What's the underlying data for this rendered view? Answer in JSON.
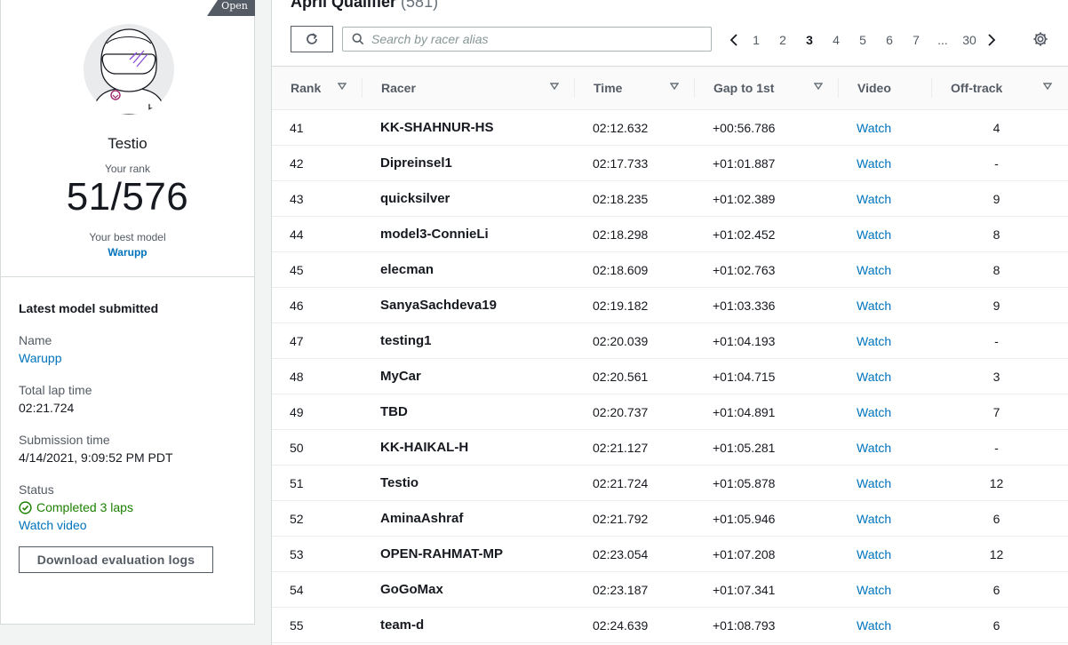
{
  "profile": {
    "badge": "Open",
    "racer_name": "Testio",
    "rank_label": "Your rank",
    "rank_value": "51/576",
    "best_model_label": "Your best model",
    "best_model": "Warupp"
  },
  "latest_model": {
    "heading": "Latest model submitted",
    "name_label": "Name",
    "name": "Warupp",
    "lap_label": "Total lap time",
    "lap_time": "02:21.724",
    "submission_label": "Submission time",
    "submission_time": "4/14/2021, 9:09:52 PM PDT",
    "status_label": "Status",
    "status": "Completed 3 laps",
    "watch_video": "Watch video",
    "download_button": "Download evaluation logs"
  },
  "leaderboard": {
    "title": "April Qualifier",
    "count": "(581)",
    "search_placeholder": "Search by racer alias",
    "pages": [
      "1",
      "2",
      "3",
      "4",
      "5",
      "6",
      "7"
    ],
    "current_page": "3",
    "ellipsis": "...",
    "last_page": "30",
    "columns": {
      "rank": "Rank",
      "racer": "Racer",
      "time": "Time",
      "gap": "Gap to 1st",
      "video": "Video",
      "offtrack": "Off-track"
    },
    "rows": [
      {
        "rank": "41",
        "racer": "KK-SHAHNUR-HS",
        "time": "02:12.632",
        "gap": "+00:56.786",
        "video": "Watch",
        "offtrack": "4"
      },
      {
        "rank": "42",
        "racer": "Dipreinsel1",
        "time": "02:17.733",
        "gap": "+01:01.887",
        "video": "Watch",
        "offtrack": "-"
      },
      {
        "rank": "43",
        "racer": "quicksilver",
        "time": "02:18.235",
        "gap": "+01:02.389",
        "video": "Watch",
        "offtrack": "9"
      },
      {
        "rank": "44",
        "racer": "model3-ConnieLi",
        "time": "02:18.298",
        "gap": "+01:02.452",
        "video": "Watch",
        "offtrack": "8"
      },
      {
        "rank": "45",
        "racer": "elecman",
        "time": "02:18.609",
        "gap": "+01:02.763",
        "video": "Watch",
        "offtrack": "8"
      },
      {
        "rank": "46",
        "racer": "SanyaSachdeva19",
        "time": "02:19.182",
        "gap": "+01:03.336",
        "video": "Watch",
        "offtrack": "9"
      },
      {
        "rank": "47",
        "racer": "testing1",
        "time": "02:20.039",
        "gap": "+01:04.193",
        "video": "Watch",
        "offtrack": "-"
      },
      {
        "rank": "48",
        "racer": "MyCar",
        "time": "02:20.561",
        "gap": "+01:04.715",
        "video": "Watch",
        "offtrack": "3"
      },
      {
        "rank": "49",
        "racer": "TBD",
        "time": "02:20.737",
        "gap": "+01:04.891",
        "video": "Watch",
        "offtrack": "7"
      },
      {
        "rank": "50",
        "racer": "KK-HAIKAL-H",
        "time": "02:21.127",
        "gap": "+01:05.281",
        "video": "Watch",
        "offtrack": "-"
      },
      {
        "rank": "51",
        "racer": "Testio",
        "time": "02:21.724",
        "gap": "+01:05.878",
        "video": "Watch",
        "offtrack": "12"
      },
      {
        "rank": "52",
        "racer": "AminaAshraf",
        "time": "02:21.792",
        "gap": "+01:05.946",
        "video": "Watch",
        "offtrack": "6"
      },
      {
        "rank": "53",
        "racer": "OPEN-RAHMAT-MP",
        "time": "02:23.054",
        "gap": "+01:07.208",
        "video": "Watch",
        "offtrack": "12"
      },
      {
        "rank": "54",
        "racer": "GoGoMax",
        "time": "02:23.187",
        "gap": "+01:07.341",
        "video": "Watch",
        "offtrack": "6"
      },
      {
        "rank": "55",
        "racer": "team-d",
        "time": "02:24.639",
        "gap": "+01:08.793",
        "video": "Watch",
        "offtrack": "6"
      }
    ]
  },
  "colors": {
    "link": "#0073bb",
    "success": "#1d8102",
    "text": "#16191f",
    "muted": "#545b64"
  }
}
